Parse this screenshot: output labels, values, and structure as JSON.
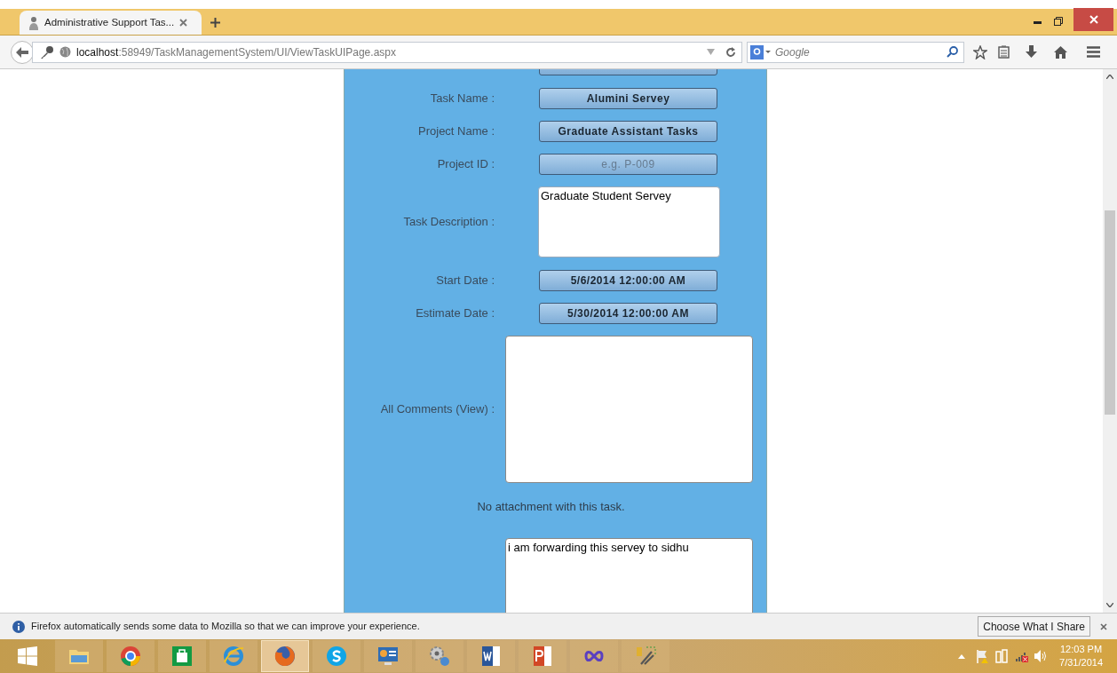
{
  "browser": {
    "tab_title": "Administrative Support Tas...",
    "url_host": "localhost",
    "url_path": ":58949/TaskManagementSystem/UI/ViewTaskUIPage.aspx",
    "search_placeholder": "Google"
  },
  "form": {
    "rows": [
      {
        "kind": "field",
        "label": "Task Name :",
        "value": "Alumini Servey"
      },
      {
        "kind": "field",
        "label": "Project Name :",
        "value": "Graduate Assistant Tasks"
      },
      {
        "kind": "field",
        "label": "Project ID :",
        "placeholder": "e.g. P-009"
      },
      {
        "kind": "memo",
        "label": "Task Description :",
        "value": "Graduate Student Servey"
      },
      {
        "kind": "field",
        "label": "Start Date :",
        "value": "5/6/2014 12:00:00 AM"
      },
      {
        "kind": "field",
        "label": "Estimate Date :",
        "value": "5/30/2014 12:00:00 AM"
      },
      {
        "kind": "comments",
        "label": "All Comments (View) :"
      },
      {
        "kind": "note",
        "text": "No attachment with this task."
      },
      {
        "kind": "comment_input",
        "value": "i am forwarding this servey to sidhu"
      }
    ]
  },
  "notification": {
    "text": "Firefox automatically sends some data to Mozilla so that we can improve your experience.",
    "button": "Choose What I Share"
  },
  "taskbar": {
    "apps": [
      {
        "kind": "explorer",
        "selected": false
      },
      {
        "kind": "chrome",
        "selected": false
      },
      {
        "kind": "store",
        "selected": false
      },
      {
        "kind": "ie",
        "selected": false
      },
      {
        "kind": "firefox",
        "selected": true
      },
      {
        "kind": "skype",
        "selected": false
      },
      {
        "kind": "monitor",
        "selected": false
      },
      {
        "kind": "gears",
        "selected": false
      },
      {
        "kind": "word",
        "selected": false
      },
      {
        "kind": "powerpoint",
        "selected": false
      },
      {
        "kind": "infinity",
        "selected": false
      },
      {
        "kind": "tools",
        "selected": false
      }
    ],
    "time": "12:03 PM",
    "date": "7/31/2014"
  }
}
